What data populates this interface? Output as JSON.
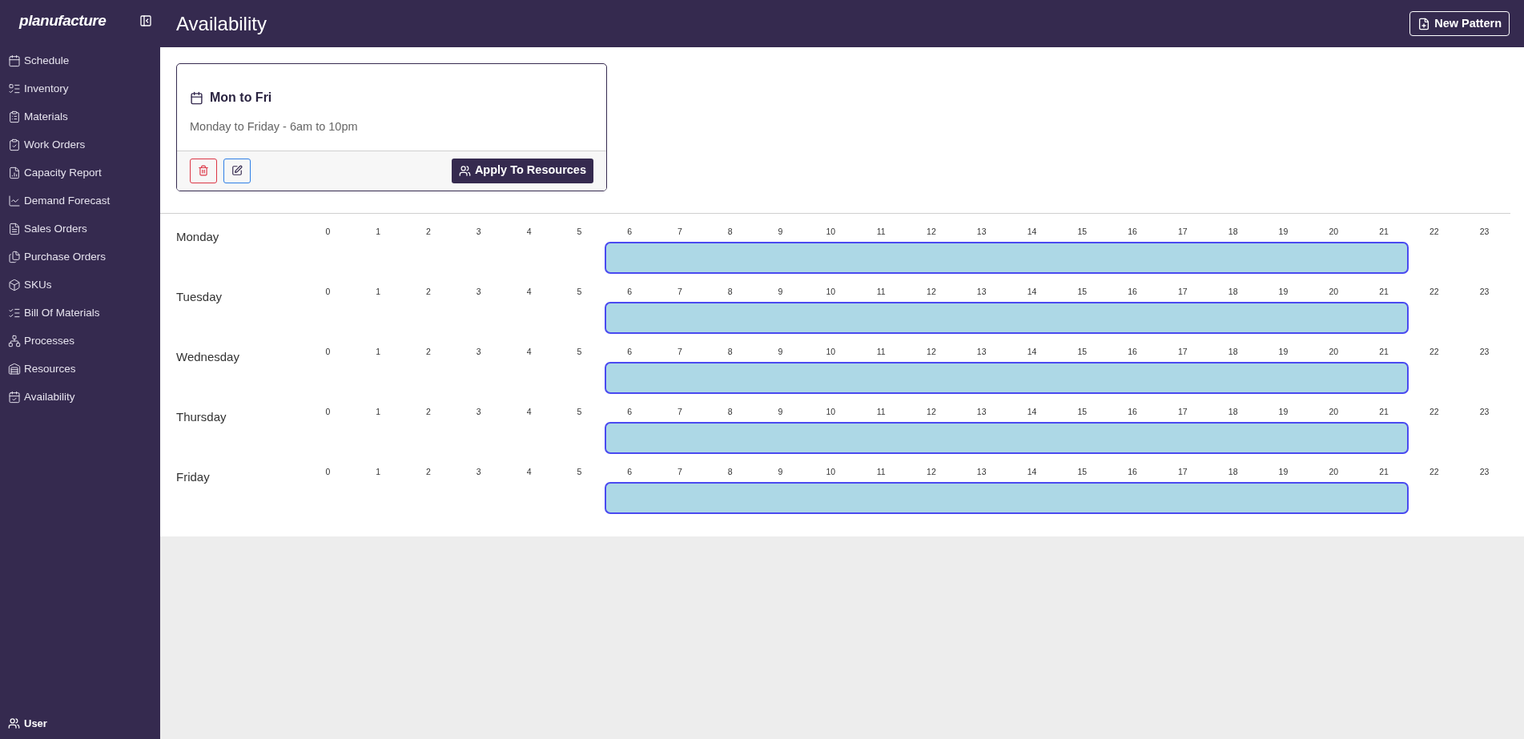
{
  "sidebar": {
    "logo": "planufacture",
    "items": [
      {
        "label": "Schedule"
      },
      {
        "label": "Inventory"
      },
      {
        "label": "Materials"
      },
      {
        "label": "Work Orders"
      },
      {
        "label": "Capacity Report"
      },
      {
        "label": "Demand Forecast"
      },
      {
        "label": "Sales Orders"
      },
      {
        "label": "Purchase Orders"
      },
      {
        "label": "SKUs"
      },
      {
        "label": "Bill Of Materials"
      },
      {
        "label": "Processes"
      },
      {
        "label": "Resources"
      },
      {
        "label": "Availability"
      }
    ],
    "user": "User"
  },
  "header": {
    "title": "Availability",
    "new_button": "New Pattern"
  },
  "pattern_card": {
    "title": "Mon to Fri",
    "description": "Monday to Friday - 6am to 10pm",
    "apply_button": "Apply To Resources"
  },
  "days": [
    {
      "name": "Monday",
      "hours": [
        {
          "label": "0",
          "available": false
        },
        {
          "label": "1",
          "available": false
        },
        {
          "label": "2",
          "available": false
        },
        {
          "label": "3",
          "available": false
        },
        {
          "label": "4",
          "available": false
        },
        {
          "label": "5",
          "available": false
        },
        {
          "label": "6",
          "available": true
        },
        {
          "label": "7",
          "available": true
        },
        {
          "label": "8",
          "available": true
        },
        {
          "label": "9",
          "available": true
        },
        {
          "label": "10",
          "available": true
        },
        {
          "label": "11",
          "available": true
        },
        {
          "label": "12",
          "available": true
        },
        {
          "label": "13",
          "available": true
        },
        {
          "label": "14",
          "available": true
        },
        {
          "label": "15",
          "available": true
        },
        {
          "label": "16",
          "available": true
        },
        {
          "label": "17",
          "available": true
        },
        {
          "label": "18",
          "available": true
        },
        {
          "label": "19",
          "available": true
        },
        {
          "label": "20",
          "available": true
        },
        {
          "label": "21",
          "available": true
        },
        {
          "label": "22",
          "available": false
        },
        {
          "label": "23",
          "available": false
        }
      ]
    },
    {
      "name": "Tuesday",
      "hours": [
        {
          "label": "0",
          "available": false
        },
        {
          "label": "1",
          "available": false
        },
        {
          "label": "2",
          "available": false
        },
        {
          "label": "3",
          "available": false
        },
        {
          "label": "4",
          "available": false
        },
        {
          "label": "5",
          "available": false
        },
        {
          "label": "6",
          "available": true
        },
        {
          "label": "7",
          "available": true
        },
        {
          "label": "8",
          "available": true
        },
        {
          "label": "9",
          "available": true
        },
        {
          "label": "10",
          "available": true
        },
        {
          "label": "11",
          "available": true
        },
        {
          "label": "12",
          "available": true
        },
        {
          "label": "13",
          "available": true
        },
        {
          "label": "14",
          "available": true
        },
        {
          "label": "15",
          "available": true
        },
        {
          "label": "16",
          "available": true
        },
        {
          "label": "17",
          "available": true
        },
        {
          "label": "18",
          "available": true
        },
        {
          "label": "19",
          "available": true
        },
        {
          "label": "20",
          "available": true
        },
        {
          "label": "21",
          "available": true
        },
        {
          "label": "22",
          "available": false
        },
        {
          "label": "23",
          "available": false
        }
      ]
    },
    {
      "name": "Wednesday",
      "hours": [
        {
          "label": "0",
          "available": false
        },
        {
          "label": "1",
          "available": false
        },
        {
          "label": "2",
          "available": false
        },
        {
          "label": "3",
          "available": false
        },
        {
          "label": "4",
          "available": false
        },
        {
          "label": "5",
          "available": false
        },
        {
          "label": "6",
          "available": true
        },
        {
          "label": "7",
          "available": true
        },
        {
          "label": "8",
          "available": true
        },
        {
          "label": "9",
          "available": true
        },
        {
          "label": "10",
          "available": true
        },
        {
          "label": "11",
          "available": true
        },
        {
          "label": "12",
          "available": true
        },
        {
          "label": "13",
          "available": true
        },
        {
          "label": "14",
          "available": true
        },
        {
          "label": "15",
          "available": true
        },
        {
          "label": "16",
          "available": true
        },
        {
          "label": "17",
          "available": true
        },
        {
          "label": "18",
          "available": true
        },
        {
          "label": "19",
          "available": true
        },
        {
          "label": "20",
          "available": true
        },
        {
          "label": "21",
          "available": true
        },
        {
          "label": "22",
          "available": false
        },
        {
          "label": "23",
          "available": false
        }
      ]
    },
    {
      "name": "Thursday",
      "hours": [
        {
          "label": "0",
          "available": false
        },
        {
          "label": "1",
          "available": false
        },
        {
          "label": "2",
          "available": false
        },
        {
          "label": "3",
          "available": false
        },
        {
          "label": "4",
          "available": false
        },
        {
          "label": "5",
          "available": false
        },
        {
          "label": "6",
          "available": true
        },
        {
          "label": "7",
          "available": true
        },
        {
          "label": "8",
          "available": true
        },
        {
          "label": "9",
          "available": true
        },
        {
          "label": "10",
          "available": true
        },
        {
          "label": "11",
          "available": true
        },
        {
          "label": "12",
          "available": true
        },
        {
          "label": "13",
          "available": true
        },
        {
          "label": "14",
          "available": true
        },
        {
          "label": "15",
          "available": true
        },
        {
          "label": "16",
          "available": true
        },
        {
          "label": "17",
          "available": true
        },
        {
          "label": "18",
          "available": true
        },
        {
          "label": "19",
          "available": true
        },
        {
          "label": "20",
          "available": true
        },
        {
          "label": "21",
          "available": true
        },
        {
          "label": "22",
          "available": false
        },
        {
          "label": "23",
          "available": false
        }
      ]
    },
    {
      "name": "Friday",
      "hours": [
        {
          "label": "0",
          "available": false
        },
        {
          "label": "1",
          "available": false
        },
        {
          "label": "2",
          "available": false
        },
        {
          "label": "3",
          "available": false
        },
        {
          "label": "4",
          "available": false
        },
        {
          "label": "5",
          "available": false
        },
        {
          "label": "6",
          "available": true
        },
        {
          "label": "7",
          "available": true
        },
        {
          "label": "8",
          "available": true
        },
        {
          "label": "9",
          "available": true
        },
        {
          "label": "10",
          "available": true
        },
        {
          "label": "11",
          "available": true
        },
        {
          "label": "12",
          "available": true
        },
        {
          "label": "13",
          "available": true
        },
        {
          "label": "14",
          "available": true
        },
        {
          "label": "15",
          "available": true
        },
        {
          "label": "16",
          "available": true
        },
        {
          "label": "17",
          "available": true
        },
        {
          "label": "18",
          "available": true
        },
        {
          "label": "19",
          "available": true
        },
        {
          "label": "20",
          "available": true
        },
        {
          "label": "21",
          "available": true
        },
        {
          "label": "22",
          "available": false
        },
        {
          "label": "23",
          "available": false
        }
      ]
    }
  ]
}
